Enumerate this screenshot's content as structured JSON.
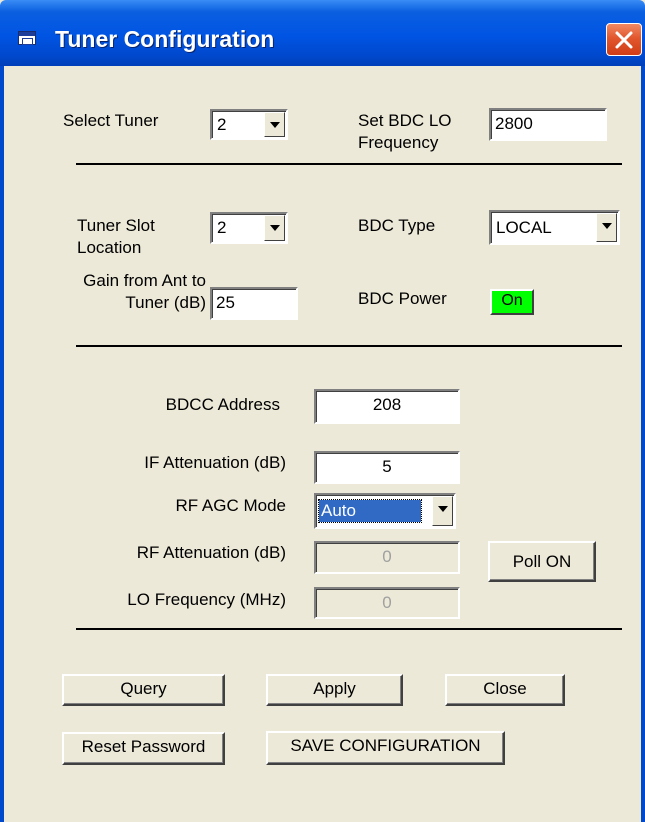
{
  "window": {
    "title": "Tuner Configuration"
  },
  "top": {
    "select_tuner_label": "Select Tuner",
    "select_tuner_value": "2",
    "bdc_lo_label": "Set BDC LO Frequency",
    "bdc_lo_value": "2800"
  },
  "middle": {
    "slot_label": "Tuner Slot Location",
    "slot_value": "2",
    "bdc_type_label": "BDC Type",
    "bdc_type_value": "LOCAL",
    "gain_label": "Gain from Ant to Tuner (dB)",
    "gain_value": "25",
    "bdc_power_label": "BDC Power",
    "bdc_power_value": "On"
  },
  "bdcc": {
    "address_label": "BDCC Address",
    "address_value": "208",
    "if_atten_label": "IF Attenuation (dB)",
    "if_atten_value": "5",
    "rf_agc_label": "RF AGC Mode",
    "rf_agc_value": "Auto",
    "rf_atten_label": "RF Attenuation (dB)",
    "rf_atten_value": "0",
    "lo_freq_label": "LO Frequency (MHz)",
    "lo_freq_value": "0",
    "poll_label": "Poll ON"
  },
  "buttons": {
    "query": "Query",
    "apply": "Apply",
    "close": "Close",
    "reset_password": "Reset Password",
    "save_configuration": "SAVE CONFIGURATION"
  },
  "colors": {
    "title_bar": "#0054e3",
    "dialog_bg": "#ece9d8",
    "power_on": "#00ff00",
    "selection": "#316ac5",
    "close_button": "#e2572e"
  },
  "icons": {
    "window_icon": "window-app-icon",
    "close_icon": "close-x-icon",
    "dropdown_icon": "chevron-down-icon"
  }
}
